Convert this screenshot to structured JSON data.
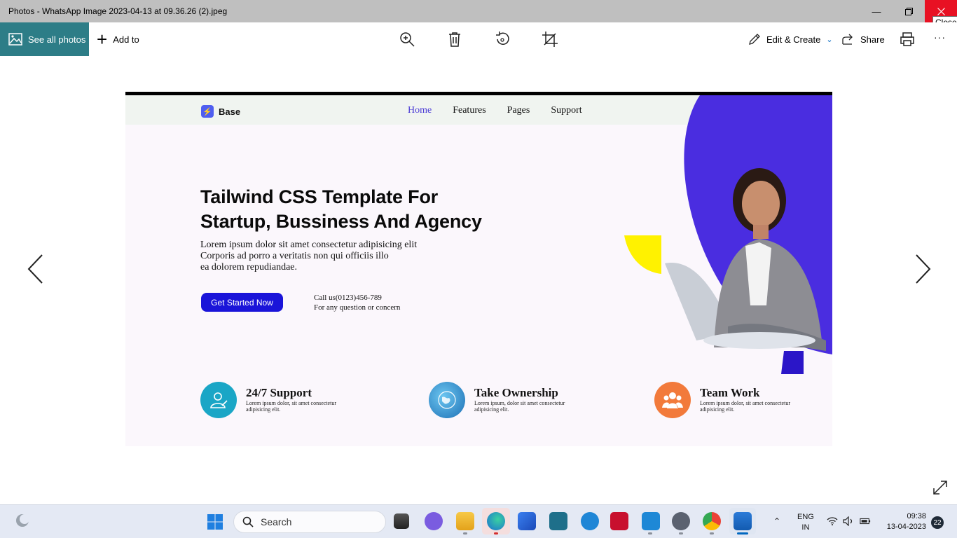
{
  "window": {
    "title": "Photos - WhatsApp Image 2023-04-13 at 09.36.26 (2).jpeg",
    "minimize_icon": "minimize-icon",
    "maximize_icon": "restore-icon",
    "close_icon": "close-icon",
    "close_tooltip": "Close"
  },
  "toolbar": {
    "see_all_label": "See all photos",
    "add_to_label": "Add to",
    "edit_create_label": "Edit & Create",
    "share_label": "Share",
    "more_label": "···",
    "icons": [
      "zoom-icon",
      "delete-icon",
      "rotate-icon",
      "crop-icon",
      "print-icon"
    ]
  },
  "photo": {
    "logo_text": "Base",
    "menu": [
      "Home",
      "Features",
      "Pages",
      "Support"
    ],
    "hero_title_line1": "Tailwind CSS Template For",
    "hero_title_line2": "Startup, Bussiness And Agency",
    "desc_line1": "Lorem ipsum dolor sit amet consectetur adipisicing elit",
    "desc_line2": "Corporis ad porro a veritatis non qui officiis illo",
    "desc_line3": "ea dolorem repudiandae.",
    "cta_label": "Get Started Now",
    "call_line1": "Call us(0123)456-789",
    "call_line2": "For any question or concern",
    "features": [
      {
        "title": "24/7 Support",
        "desc_line1": "Lorem ipsum dolor, sit amet consectetur",
        "desc_line2": "adipisicing elit.",
        "color": "#1aa6c6"
      },
      {
        "title": "Take Ownership",
        "desc_line1": "Lorem ipsum, dolor sit amet consectetur",
        "desc_line2": "adipisicing elit.",
        "color": "#2b8fd1"
      },
      {
        "title": "Team Work",
        "desc_line1": "Lorem ipsum dolor, sit amet consectetur",
        "desc_line2": "adipisicing elit.",
        "color": "#f27a3b"
      }
    ],
    "accent_color": "#4a2de0"
  },
  "taskbar": {
    "search_placeholder": "Search",
    "lang_line1": "ENG",
    "lang_line2": "IN",
    "time": "09:38",
    "date": "13-04-2023",
    "notification_count": "22"
  }
}
